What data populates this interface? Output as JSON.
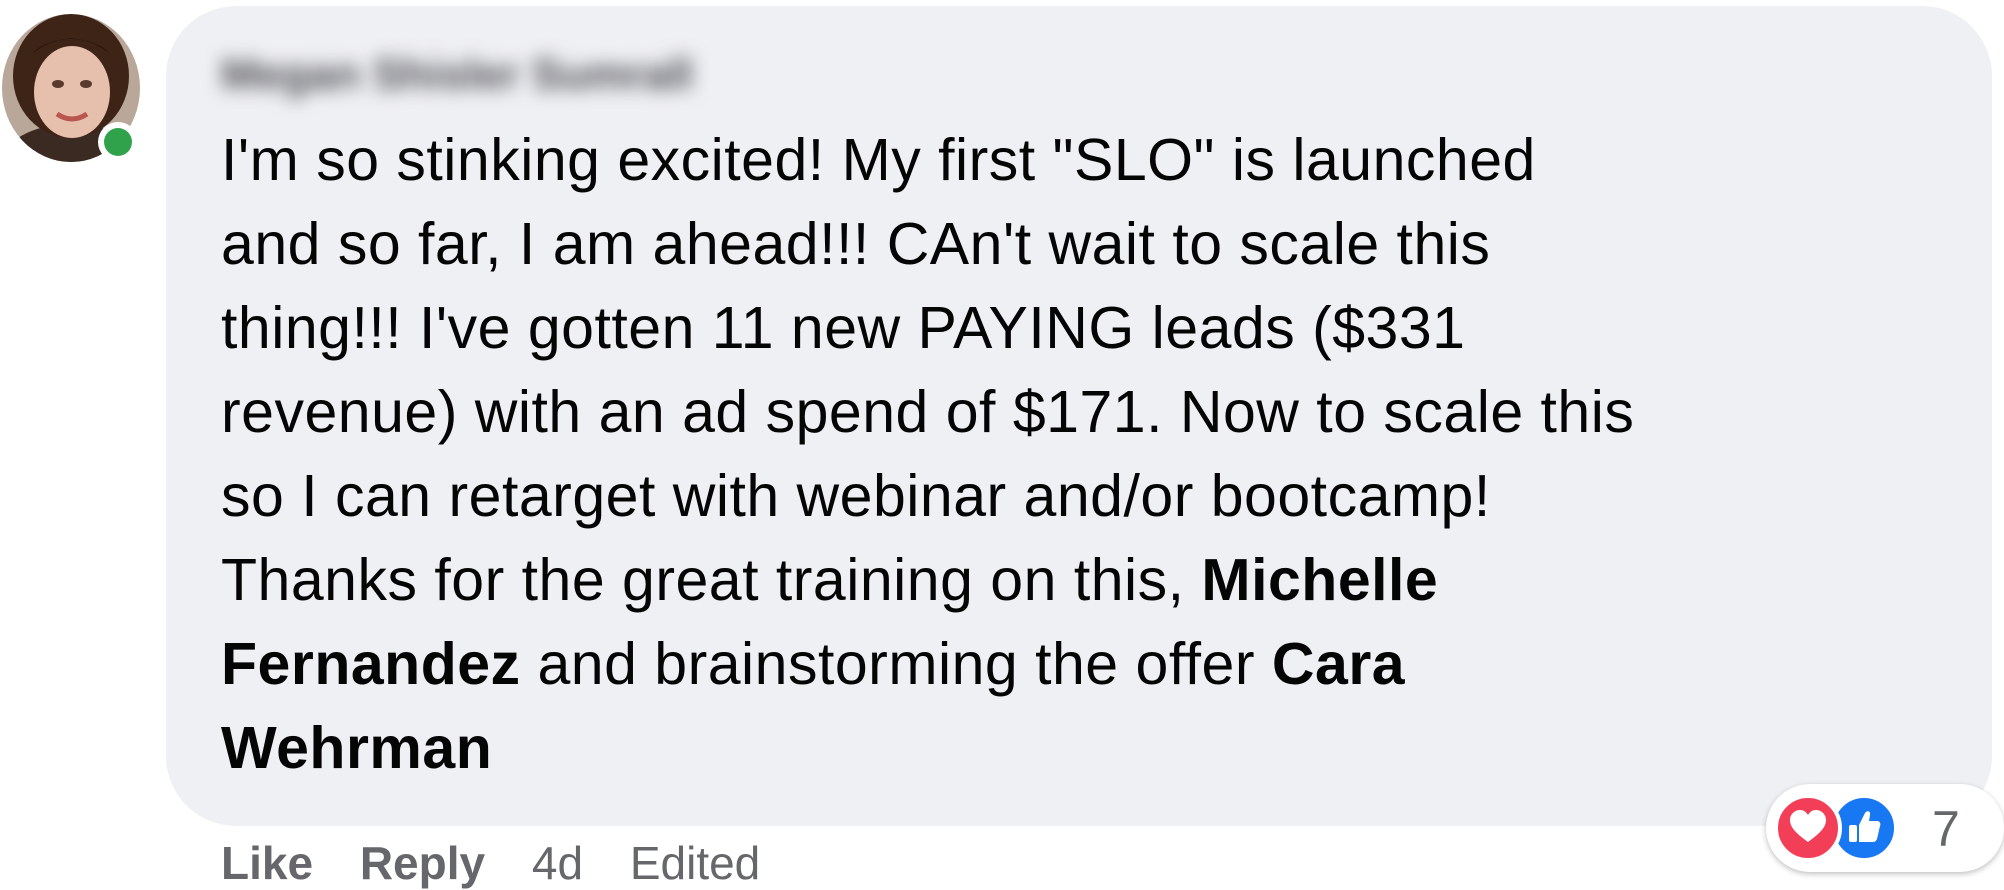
{
  "comment": {
    "author": "Megan Shisler Sumrall",
    "lines": [
      "I'm so stinking excited! My first \"SLO\" is launched",
      "and so far, I am ahead!!! CAn't wait to scale this",
      "thing!!! I've gotten 11 new PAYING leads ($331",
      "revenue) with an ad spend of $171. Now to scale this",
      "so I can retarget with webinar and/or bootcamp!"
    ],
    "line6_pre": "Thanks for the great training on this, ",
    "mention1_part1": "Michelle",
    "mention1_part2": "Fernandez",
    "line7_mid": " and brainstorming the offer ",
    "mention2_part1": "Cara",
    "mention2_part2": "Wehrman"
  },
  "actions": {
    "like": "Like",
    "reply": "Reply",
    "time": "4d",
    "edited": "Edited"
  },
  "reactions": {
    "icons": [
      "love-icon",
      "like-icon"
    ],
    "count": "7",
    "love_color": "#f33e58",
    "like_color": "#1877f2"
  },
  "colors": {
    "bubble": "#eff0f4",
    "text": "#050505",
    "meta": "#65676b",
    "presence": "#31a24c"
  }
}
